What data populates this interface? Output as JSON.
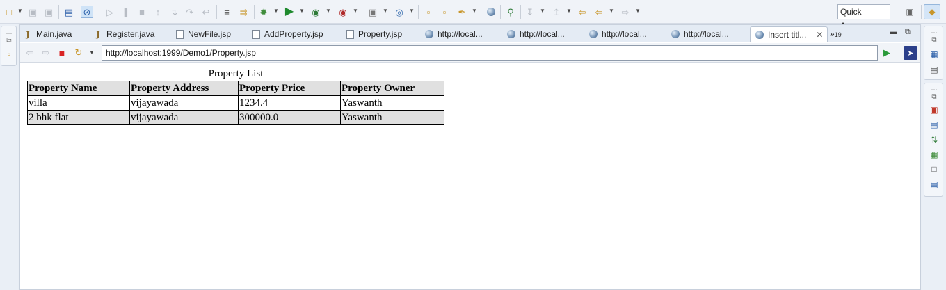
{
  "toolbar": {
    "icons": [
      "new-wizard-icon",
      "save-icon",
      "save-all-icon",
      "terminal-icon",
      "skip-breakpoints-icon",
      "resume-icon",
      "suspend-icon",
      "terminate-icon",
      "disconnect-icon",
      "step-into-icon",
      "step-over-icon",
      "step-return-icon",
      "use-step-filters-icon",
      "run-last-tool-icon",
      "debug-icon",
      "run-icon",
      "coverage-icon",
      "external-tools-icon",
      "new-server-icon",
      "new-web-service-icon",
      "open-type-icon",
      "open-task-icon",
      "open-folder-icon",
      "search-icon",
      "globe-icon",
      "next-annotation-icon",
      "prev-annotation-icon",
      "last-edit-icon",
      "back-icon",
      "forward-icon"
    ],
    "quick_access_placeholder": "Quick Access"
  },
  "tabs": [
    {
      "label": "Main.java",
      "icon": "java-file-icon"
    },
    {
      "label": "Register.java",
      "icon": "java-file-icon"
    },
    {
      "label": "NewFile.jsp",
      "icon": "jsp-file-icon"
    },
    {
      "label": "AddProperty.jsp",
      "icon": "jsp-file-icon"
    },
    {
      "label": "Property.jsp",
      "icon": "jsp-file-icon"
    },
    {
      "label": "http://local...",
      "icon": "globe-icon"
    },
    {
      "label": "http://local...",
      "icon": "globe-icon"
    },
    {
      "label": "http://local...",
      "icon": "globe-icon"
    },
    {
      "label": "http://local...",
      "icon": "globe-icon"
    },
    {
      "label": "Insert titl...",
      "icon": "globe-icon",
      "active": true
    }
  ],
  "tab_overflow": {
    "symbol": "»",
    "count": "19"
  },
  "browser": {
    "url": "http://localhost:1999/Demo1/Property.jsp"
  },
  "page": {
    "caption": "Property List",
    "columns": [
      "Property Name",
      "Property Address",
      "Property Price",
      "Property Owner"
    ],
    "rows": [
      [
        "villa",
        "vijayawada",
        "1234.4",
        "Yaswanth"
      ],
      [
        "2 bhk flat",
        "vijayawada",
        "300000.0",
        "Yaswanth"
      ]
    ]
  }
}
